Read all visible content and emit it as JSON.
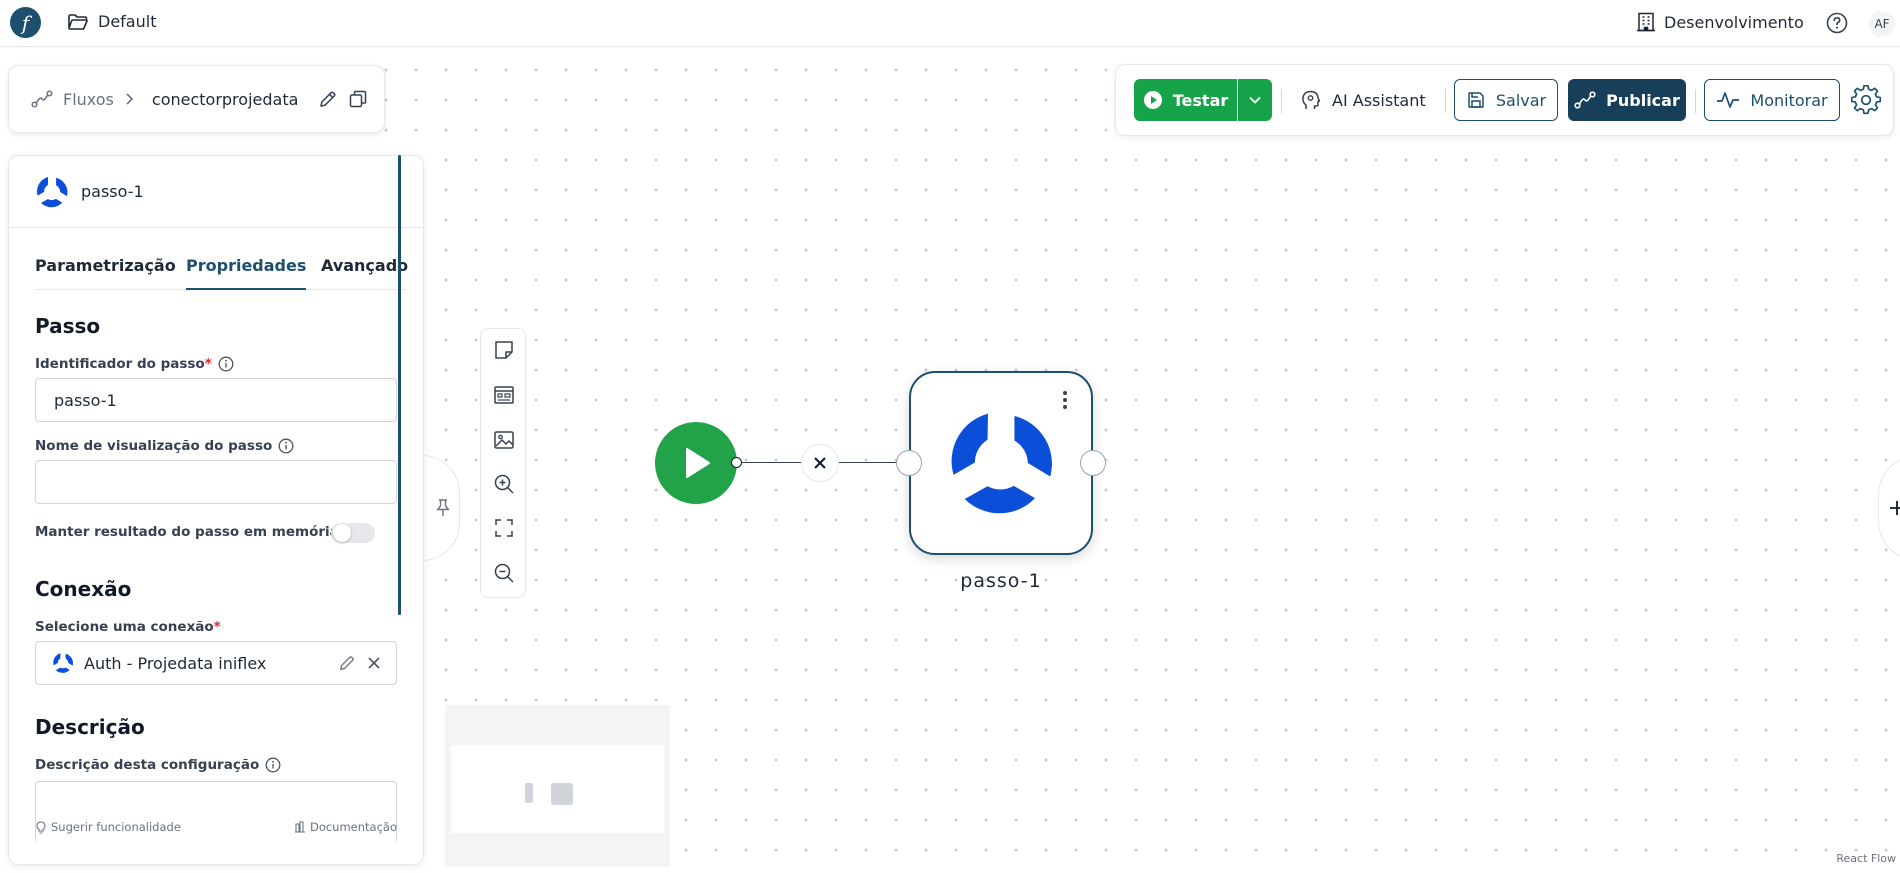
{
  "topbar": {
    "logo_glyph": "f",
    "workspace": "Default",
    "environment": "Desenvolvimento",
    "avatar_initials": "AF"
  },
  "breadcrumb": {
    "root": "Fluxos",
    "current": "conectorprojedata"
  },
  "actions": {
    "test": "Testar",
    "ai": "AI Assistant",
    "save": "Salvar",
    "publish": "Publicar",
    "monitor": "Monitorar"
  },
  "panel": {
    "step_name": "passo-1",
    "tabs": [
      "Parametrização",
      "Propriedades",
      "Avançado"
    ],
    "active_tab": "Propriedades",
    "sections": {
      "step_title": "Passo",
      "step_id_label": "Identificador do passo",
      "step_id_value": "passo-1",
      "display_name_label": "Nome de visualização do passo",
      "display_name_value": "",
      "memory_label": "Manter resultado do passo em memória",
      "memory_enabled": false,
      "connection_title": "Conexão",
      "connection_label": "Selecione uma conexão",
      "connection_value": "Auth - Projedata iniflex",
      "description_title": "Descrição",
      "description_label": "Descrição desta configuração"
    },
    "footer": {
      "suggest": "Sugerir funcionalidade",
      "docs": "Documentação"
    }
  },
  "flow": {
    "node_label": "passo-1",
    "attribution": "React Flow"
  },
  "colors": {
    "brand": "#1d4f6e",
    "test_green": "#16a34a",
    "start_green": "#22a34a",
    "node_blue": "#0b4fd9",
    "required": "#dc2626"
  }
}
